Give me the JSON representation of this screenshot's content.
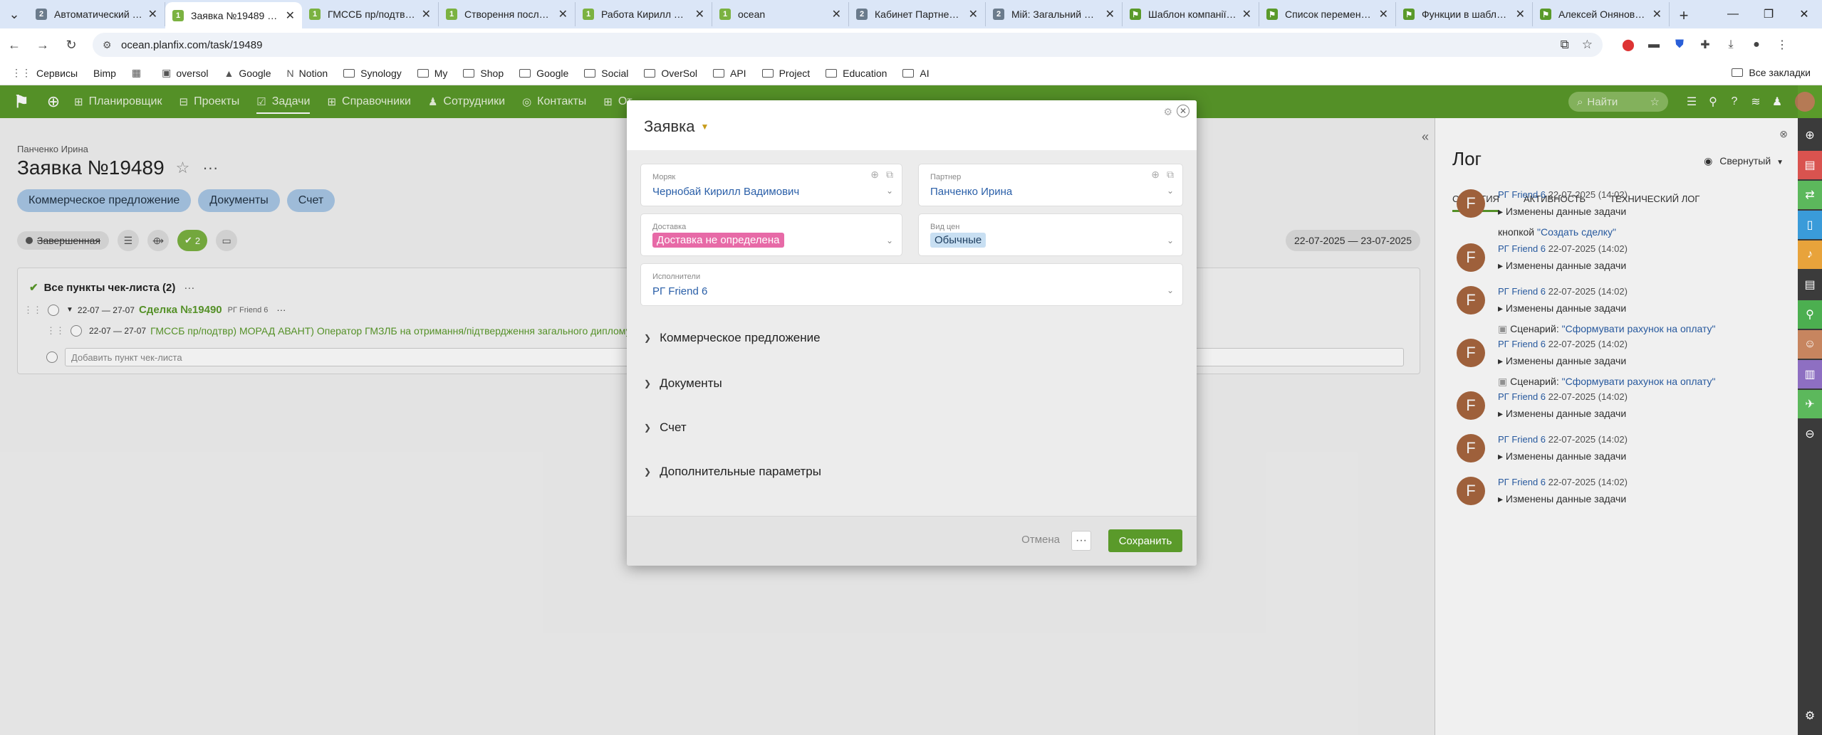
{
  "browser": {
    "tabs": [
      {
        "title": "Автоматический сце",
        "fav": "2",
        "color": "#6b7b8c",
        "active": false
      },
      {
        "title": "Заявка №19489 / Пан",
        "fav": "1",
        "color": "#7bb241",
        "active": true
      },
      {
        "title": "ГМССБ пр/подтвр) М",
        "fav": "1",
        "color": "#7bb241",
        "active": false
      },
      {
        "title": "Створення послуги",
        "fav": "1",
        "color": "#7bb241",
        "active": false
      },
      {
        "title": "Работа Кирилл Алекс",
        "fav": "1",
        "color": "#7bb241",
        "active": false
      },
      {
        "title": "ocean",
        "fav": "1",
        "color": "#7bb241",
        "active": false
      },
      {
        "title": "Кабинет Партнера / с",
        "fav": "2",
        "color": "#6b7b8c",
        "active": false
      },
      {
        "title": "Мій: Загальний розр",
        "fav": "2",
        "color": "#6b7b8c",
        "active": false
      },
      {
        "title": "Шаблон компанії / Ко",
        "fav": "⚑",
        "color": "#5a9a2a",
        "active": false
      },
      {
        "title": "Список переменных",
        "fav": "⚑",
        "color": "#5a9a2a",
        "active": false
      },
      {
        "title": "Функции в шаблонах",
        "fav": "⚑",
        "color": "#5a9a2a",
        "active": false
      },
      {
        "title": "Алексей Онянов / Со",
        "fav": "⚑",
        "color": "#5a9a2a",
        "active": false
      }
    ],
    "url": "ocean.planfix.com/task/19489",
    "bookmarks": [
      {
        "label": "Сервисы",
        "icon": "grid-icon"
      },
      {
        "label": "Bimp",
        "icon": "none"
      },
      {
        "label": "",
        "icon": "apps-icon"
      },
      {
        "label": "oversol",
        "icon": "planfix-icon"
      },
      {
        "label": "Google",
        "icon": "drive-icon"
      },
      {
        "label": "Notion",
        "icon": "notion-icon"
      },
      {
        "label": "Synology",
        "icon": "folder-icon"
      },
      {
        "label": "My",
        "icon": "folder-icon"
      },
      {
        "label": "Shop",
        "icon": "folder-icon"
      },
      {
        "label": "Google",
        "icon": "folder-icon"
      },
      {
        "label": "Social",
        "icon": "folder-icon"
      },
      {
        "label": "OverSol",
        "icon": "folder-icon"
      },
      {
        "label": "API",
        "icon": "folder-icon"
      },
      {
        "label": "Project",
        "icon": "folder-icon"
      },
      {
        "label": "Education",
        "icon": "folder-icon"
      },
      {
        "label": "AI",
        "icon": "folder-icon"
      }
    ],
    "all_bookmarks": "Все закладки"
  },
  "app": {
    "nav": [
      {
        "label": "Планировщик",
        "active": false
      },
      {
        "label": "Проекты",
        "active": false
      },
      {
        "label": "Задачи",
        "active": true
      },
      {
        "label": "Справочники",
        "active": false
      },
      {
        "label": "Сотрудники",
        "active": false
      },
      {
        "label": "Контакты",
        "active": false
      },
      {
        "label": "От",
        "active": false
      }
    ],
    "search_placeholder": "Найти",
    "accent": "#5a9a2a"
  },
  "task": {
    "breadcrumb": "Панченко Ирина",
    "title": "Заявка №19489",
    "pills": [
      "Коммерческое предложение",
      "Документы",
      "Счет"
    ],
    "status": "Завершенная",
    "check_count": "2",
    "date_range": "22-07-2025 — 23-07-2025",
    "checklist": {
      "header": "Все пункты чек-листа (2)",
      "row1_date": "22-07 — 27-07",
      "row1_link": "Сделка №19490",
      "row1_user": "РГ Friend 6",
      "row2_date": "22-07 — 27-07",
      "row2_text": "ГМССБ пр/подтвр) МОРАД АВАНТ) Оператор ГМЗЛБ на отримання/підтвердження загального диплому) Т",
      "add_placeholder": "Добавить пункт чек-листа"
    }
  },
  "log": {
    "title": "Лог",
    "mode": "Свернутый",
    "tabs": [
      "СОБЫТИЯ",
      "АКТИВНОСТЬ",
      "ТЕХНИЧЕСКИЙ ЛОГ"
    ],
    "entries": [
      {
        "who": "РГ Friend 6",
        "date": "22-07-2025 (14:02)",
        "what": "Изменены данные задачи",
        "extra_prefix": "кнопкой",
        "extra_link": "\"Создать сделку\""
      },
      {
        "who": "РГ Friend 6",
        "date": "22-07-2025 (14:02)",
        "what": "Изменены данные задачи",
        "extra_prefix": "",
        "extra_link": ""
      },
      {
        "who": "РГ Friend 6",
        "date": "22-07-2025 (14:02)",
        "what": "Изменены данные задачи",
        "extra_prefix": "Сценарий:",
        "extra_link": "\"Сформувати рахунок на оплату\""
      },
      {
        "who": "РГ Friend 6",
        "date": "22-07-2025 (14:02)",
        "what": "Изменены данные задачи",
        "extra_prefix": "Сценарий:",
        "extra_link": "\"Сформувати рахунок на оплату\""
      },
      {
        "who": "РГ Friend 6",
        "date": "22-07-2025 (14:02)",
        "what": "Изменены данные задачи",
        "extra_prefix": "",
        "extra_link": ""
      },
      {
        "who": "РГ Friend 6",
        "date": "22-07-2025 (14:02)",
        "what": "Изменены данные задачи",
        "extra_prefix": "",
        "extra_link": ""
      },
      {
        "who": "РГ Friend 6",
        "date": "22-07-2025 (14:02)",
        "what": "Изменены данные задачи",
        "extra_prefix": "",
        "extra_link": ""
      }
    ],
    "avatar_letter": "F"
  },
  "modal": {
    "title": "Заявка",
    "fields": {
      "seaman_label": "Моряк",
      "seaman_value": "Чернобай Кирилл Вадимович",
      "partner_label": "Партнер",
      "partner_value": "Панченко Ирина",
      "delivery_label": "Доставка",
      "delivery_value": "Доставка не определена",
      "price_label": "Вид цен",
      "price_value": "Обычные",
      "executors_label": "Исполнители",
      "executors_value": "РГ Friend 6"
    },
    "sections": [
      "Коммерческое предложение",
      "Документы",
      "Счет",
      "Дополнительные параметры"
    ],
    "cancel": "Отмена",
    "more": "···",
    "save": "Сохранить"
  },
  "sidebar_colors": [
    "#3b3b3b",
    "#d9534f",
    "#5cb85c",
    "#3a9bd9",
    "#e8a33b",
    "#3b3b3b",
    "#4caf50",
    "#c7855f",
    "#8e6fc2",
    "#5cb85c",
    "#3b3b3b"
  ]
}
